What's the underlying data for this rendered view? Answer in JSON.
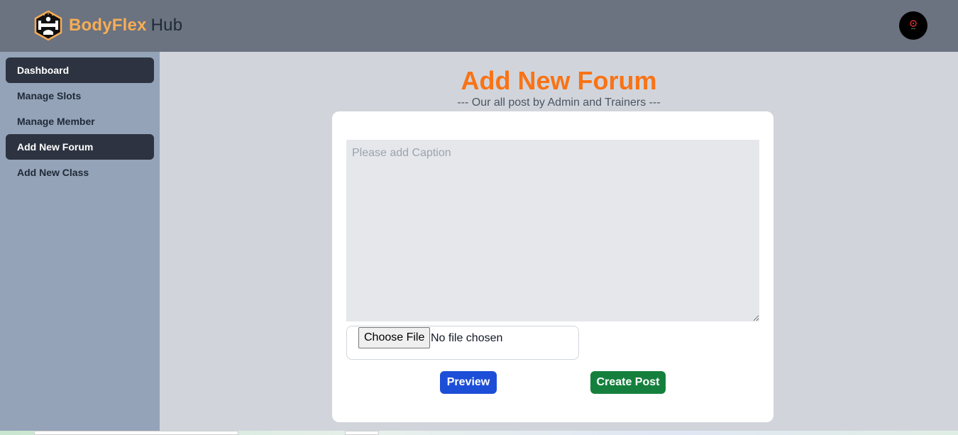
{
  "brand": {
    "name_accent": "BodyFlex",
    "name_rest": "Hub"
  },
  "sidebar": {
    "items": [
      {
        "label": "Dashboard",
        "active": true
      },
      {
        "label": "Manage Slots",
        "active": false
      },
      {
        "label": "Manage Member",
        "active": false
      },
      {
        "label": "Add New Forum",
        "active": true
      },
      {
        "label": "Add New Class",
        "active": false
      }
    ]
  },
  "page": {
    "title": "Add New Forum",
    "subtitle": "--- Our all post by Admin and Trainers ---"
  },
  "form": {
    "caption_placeholder": "Please add Caption",
    "caption_value": "",
    "file_button_label": "Choose File",
    "file_status": "No file chosen",
    "preview_label": "Preview",
    "create_label": "Create Post"
  },
  "colors": {
    "accent": "#f97316",
    "brand": "#f6ad55",
    "preview_button": "#1d4ed8",
    "create_button": "#15803d",
    "sidebar_active": "#2d3340"
  },
  "icons": {
    "logo": "dumbbell-hexagon-logo",
    "avatar": "user-avatar"
  }
}
